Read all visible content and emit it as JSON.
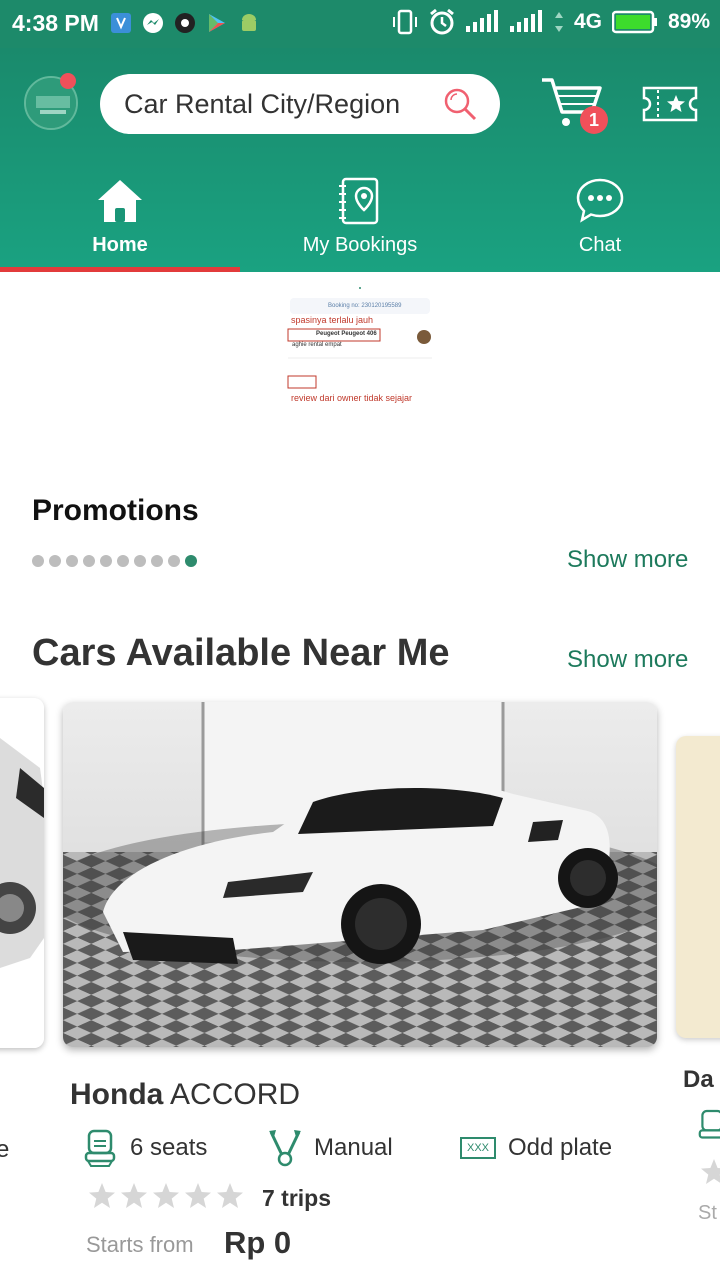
{
  "status_bar": {
    "time": "4:38 PM",
    "network": "4G",
    "battery": "89%"
  },
  "header": {
    "search_placeholder": "Car Rental City/Region",
    "cart_count": "1"
  },
  "tabs": [
    {
      "label": "Home",
      "active": true
    },
    {
      "label": "My Bookings",
      "active": false
    },
    {
      "label": "Chat",
      "active": false
    }
  ],
  "banner": {
    "booking_no": "Booking no: 230120195589",
    "line1": "spasinya terlalu jauh",
    "car_tag": "Peugeot Peugeot 406",
    "owner": "aghie rental empat",
    "line2": "review dari owner tidak sejajar"
  },
  "promotions": {
    "title": "Promotions",
    "show_more": "Show more",
    "dot_count": 10,
    "active_dot": 9
  },
  "cars_section": {
    "title": "Cars Available Near Me",
    "show_more": "Show more"
  },
  "car": {
    "brand": "Honda",
    "model": "ACCORD",
    "seats": "6 seats",
    "transmission": "Manual",
    "plate_badge": "XXX",
    "plate": "Odd plate",
    "rating": 0,
    "trips": "7 trips",
    "starts_from": "Starts from",
    "price": "Rp 0"
  },
  "peek_right": {
    "name_start": "Da",
    "price_start": "St"
  },
  "peek_left": {
    "text": "e"
  },
  "colors": {
    "primary": "#1a8a6c",
    "accent_red": "#e23b3b",
    "badge": "#f0505a"
  }
}
